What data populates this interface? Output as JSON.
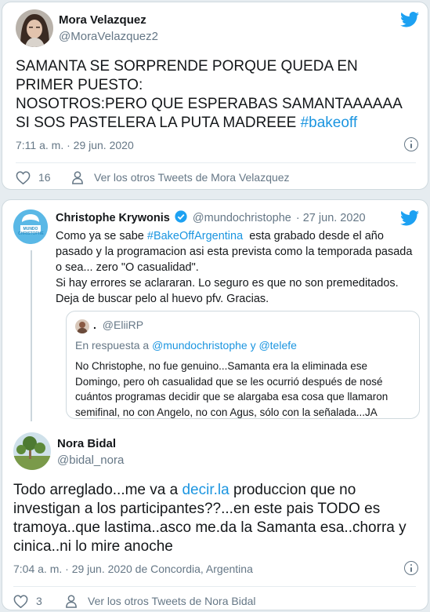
{
  "tweet1": {
    "name": "Mora Velazquez",
    "handle": "@MoraVelazquez2",
    "text_main": "SAMANTA SE SORPRENDE PORQUE QUEDA EN PRIMER PUESTO:\nNOSOTROS:PERO QUE ESPERABAS SAMANTAAAAAA SI SOS PASTELERA LA PUTA MADREEE ",
    "hashtag": "#bakeoff",
    "timestamp": "7:11 a. m. · 29 jun. 2020",
    "likes": "16",
    "more_tweets": "Ver los otros Tweets de Mora Velazquez"
  },
  "quoted": {
    "name": "Christophe Krywonis",
    "handle": "@mundochristophe",
    "date": "· 27 jun. 2020",
    "avatar_label": "MUNDO CHRISTOPHE",
    "text_before": "Como ya se sabe ",
    "hashtag": "#BakeOffArgentina",
    "text_after": "  esta grabado desde el año pasado y la programacion asi esta prevista como la temporada pasada o sea... zero \"O casualidad\".\nSi hay errores se aclararan. Lo seguro es que no son premeditados.\nDeja de buscar pelo al huevo pfv. Gracias.",
    "inner": {
      "name": ".",
      "handle": "@EliiRP",
      "reply_prefix": "En respuesta a ",
      "reply_to": "@mundochristophe y @telefe",
      "text": "No Christophe, no fue genuino...Samanta era la eliminada ese Domingo, pero oh casualidad que se les ocurrió después de nosé cuántos programas decidir que se alargaba esa cosa que llamaron semifinal, no con Angelo, no con Agus, sólo con la señalada...JA"
    }
  },
  "tweet2": {
    "name": "Nora Bidal",
    "handle": "@bidal_nora",
    "text_before": "Todo arreglado...me va a ",
    "link": "decir.la",
    "text_after": " produccion que no investigan a los participantes??...en este pais TODO es tramoya..que lastima..asco me.da la Samanta esa..chorra y cinica..ni lo mire anoche",
    "timestamp": "7:04 a. m. · 29 jun. 2020 de Concordia, Argentina",
    "likes": "3",
    "more_tweets": "Ver los otros Tweets de Nora Bidal"
  },
  "colors": {
    "link": "#1b95e0",
    "muted": "#657786",
    "text": "#14171a",
    "border": "#cfd9de"
  },
  "icons": [
    "twitter-bird-icon",
    "verified-badge-icon",
    "info-icon",
    "heart-icon",
    "person-icon"
  ]
}
